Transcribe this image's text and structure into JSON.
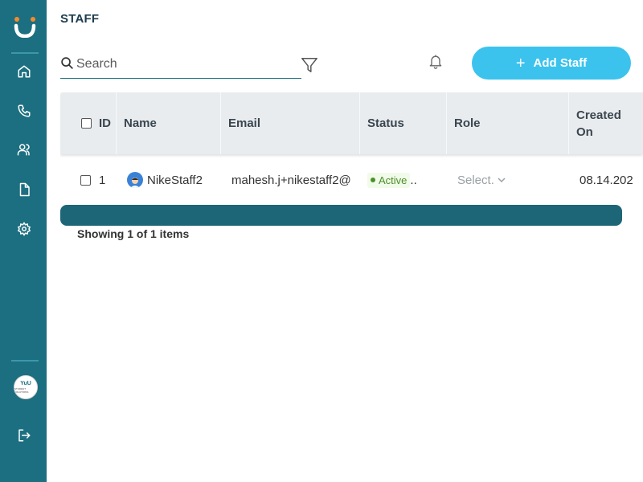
{
  "sidebar": {
    "logo": "smile-logo",
    "items": [
      {
        "name": "home",
        "icon": "home-icon"
      },
      {
        "name": "calls",
        "icon": "phone-icon"
      },
      {
        "name": "users",
        "icon": "users-icon"
      },
      {
        "name": "documents",
        "icon": "document-icon"
      },
      {
        "name": "settings",
        "icon": "gear-icon"
      }
    ],
    "org_avatar": {
      "line1": "YuU",
      "line2": "STUDENT SOLUTIONS"
    },
    "logout_icon": "logout-icon",
    "accent": "#1c6f80"
  },
  "header": {
    "title": "STAFF",
    "search_placeholder": "Search",
    "search_value": "",
    "add_button_label": "Add Staff",
    "add_button_color": "#3bc3ee"
  },
  "table": {
    "columns": [
      "ID",
      "Name",
      "Email",
      "Status",
      "Role",
      "Created On"
    ],
    "rows": [
      {
        "id": "1",
        "name": "NikeStaff2",
        "email": "mahesh.j+nikestaff2@",
        "status": "Active",
        "status_suffix": "..",
        "role": "Select.",
        "created_on": "08.14.202"
      }
    ]
  },
  "footer": {
    "showing_text": "Showing 1 of 1 items"
  }
}
